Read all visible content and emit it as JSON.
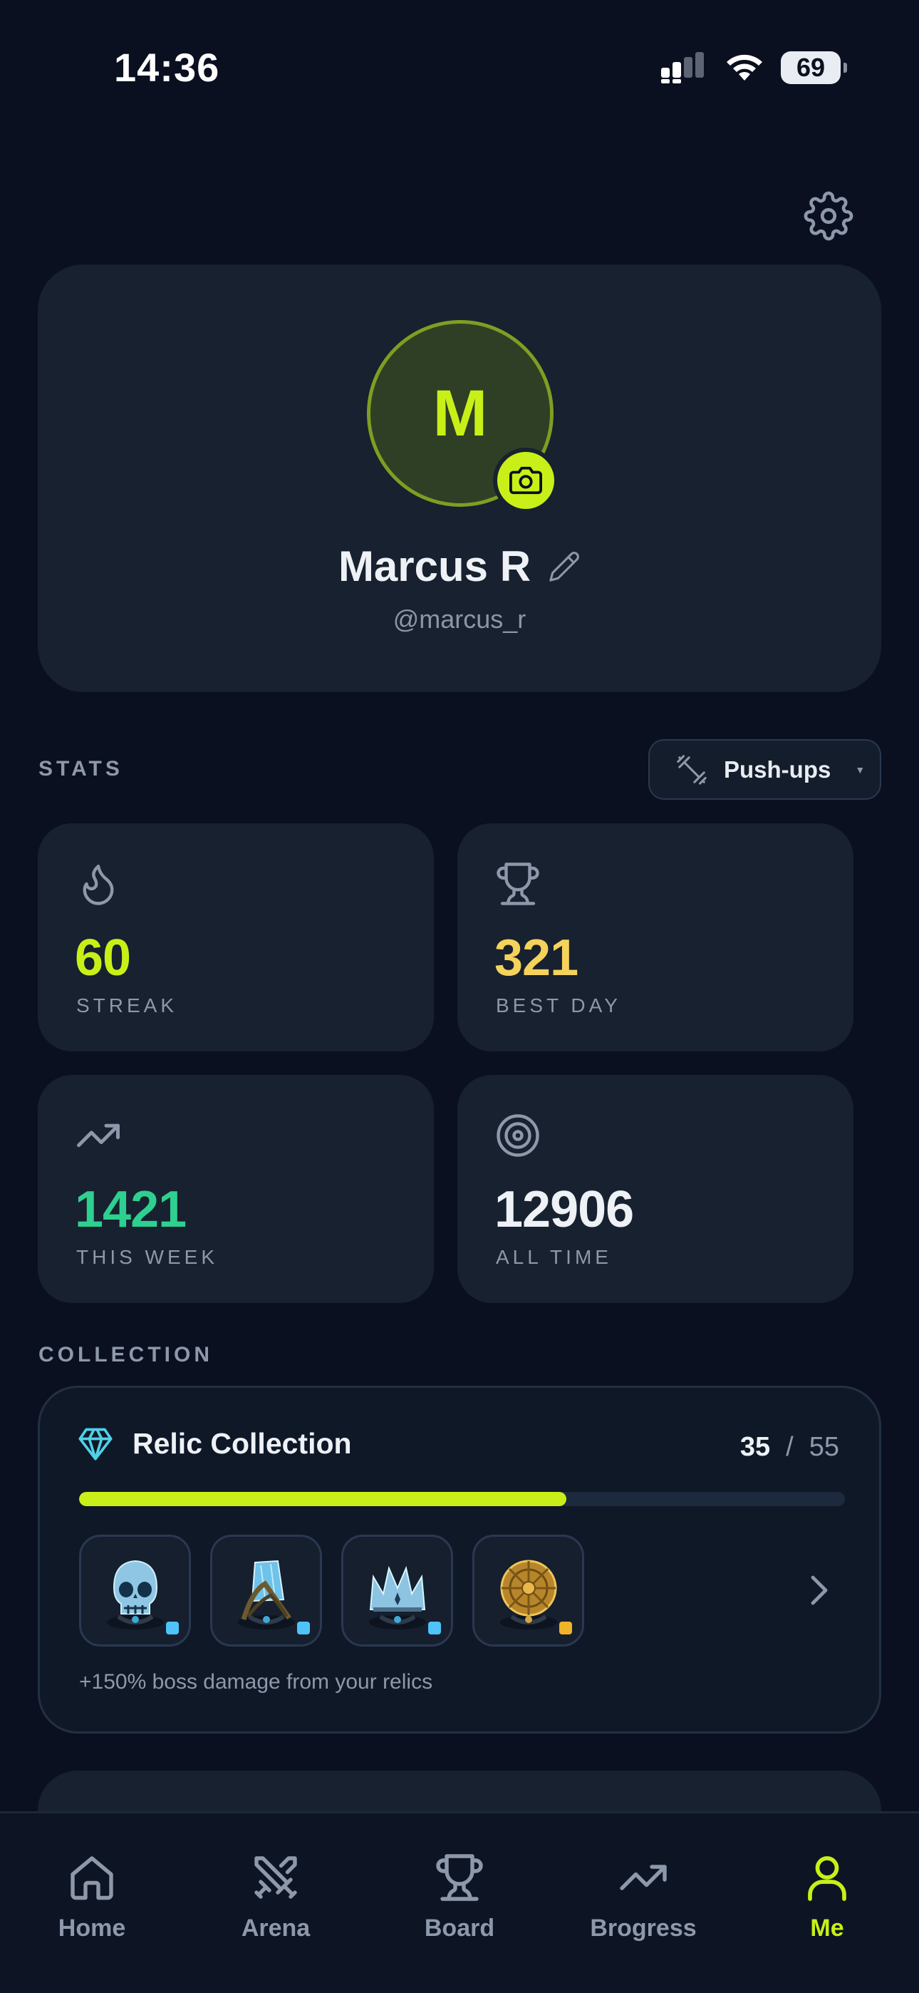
{
  "status_bar": {
    "time": "14:36",
    "battery": "69"
  },
  "profile": {
    "avatar_initial": "M",
    "name": "Marcus R",
    "handle": "@marcus_r"
  },
  "stats": {
    "section_label": "STATS",
    "exercise": "Push-ups",
    "cards": [
      {
        "icon": "flame-icon",
        "value": "60",
        "label": "STREAK",
        "color": "#c8f018"
      },
      {
        "icon": "trophy-icon",
        "value": "321",
        "label": "BEST DAY",
        "color": "#f5d35a"
      },
      {
        "icon": "trending-up-icon",
        "value": "1421",
        "label": "THIS WEEK",
        "color": "#2ed08f"
      },
      {
        "icon": "target-icon",
        "value": "12906",
        "label": "ALL TIME",
        "color": "#eef1f6"
      }
    ]
  },
  "collection": {
    "section_label": "COLLECTION",
    "title": "Relic Collection",
    "owned": "35",
    "separator": "/",
    "total": "55",
    "progress": 0.636,
    "relics": [
      {
        "name": "skull-relic",
        "rarity_color": "#4fc3f7"
      },
      {
        "name": "ice-crystal-relic",
        "rarity_color": "#4fc3f7"
      },
      {
        "name": "crown-relic",
        "rarity_color": "#4fc3f7"
      },
      {
        "name": "golden-shield-relic",
        "rarity_color": "#f0b429"
      }
    ],
    "bonus_text": "+150% boss damage from your relics"
  },
  "tabbar": {
    "tabs": [
      {
        "label": "Home",
        "icon": "home-icon"
      },
      {
        "label": "Arena",
        "icon": "crossed-swords-icon"
      },
      {
        "label": "Board",
        "icon": "trophy-icon"
      },
      {
        "label": "Brogress",
        "icon": "trending-up-icon"
      },
      {
        "label": "Me",
        "icon": "user-icon",
        "active": true
      }
    ]
  },
  "colors": {
    "accent": "#c8f018",
    "background": "#0a1020",
    "card": "#17212f"
  }
}
